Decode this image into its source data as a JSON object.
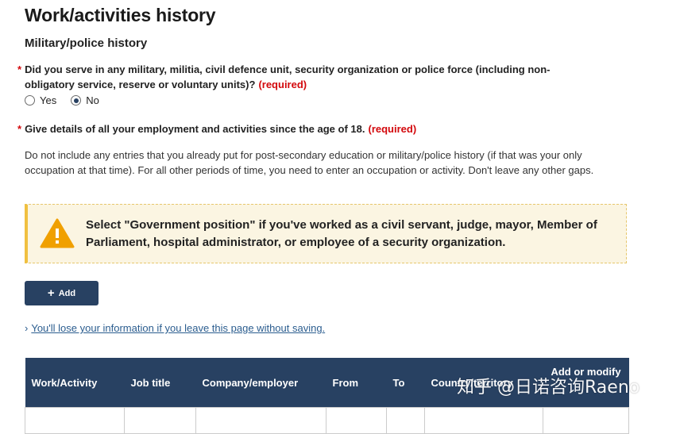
{
  "page": {
    "title": "Work/activities history",
    "section_title": "Military/police history"
  },
  "question1": {
    "star": "*",
    "text_line1": "Did you serve in any military, militia, civil defence unit, security organization or police force (including non-",
    "text_line2": "obligatory service, reserve or voluntary units)?",
    "required": "(required)",
    "options": [
      {
        "label": "Yes",
        "selected": false
      },
      {
        "label": "No",
        "selected": true
      }
    ]
  },
  "question2": {
    "star": "*",
    "text": "Give details of all your employment and activities since the age of 18.",
    "required": "(required)"
  },
  "help_text": "Do not include any entries that you already put for post-secondary education or military/police history (if that was your only occupation at that time). For all other periods of time, you need to enter an occupation or activity. Don't leave any other gaps.",
  "warning": {
    "icon": "warning-triangle-icon",
    "text": "Select \"Government position\" if you've worked as a civil servant, judge, mayor, Member of Parliament, hospital administrator, or employee of a security organization."
  },
  "add_button": {
    "icon": "+",
    "label": "Add"
  },
  "lose_link": {
    "chevron": "›",
    "text": "You'll lose your information if you leave this page without saving."
  },
  "table": {
    "headers": [
      "Work/Activity",
      "Job title",
      "Company/employer",
      "From",
      "To",
      "Country/territory",
      "Add or modify"
    ]
  },
  "watermark": "知乎 @日诺咨询Raeno",
  "colors": {
    "primary": "#284162",
    "required": "#d3080c",
    "warning_bg": "#fbf5e2",
    "warning_icon": "#f0a000",
    "link": "#2b5d8f"
  }
}
